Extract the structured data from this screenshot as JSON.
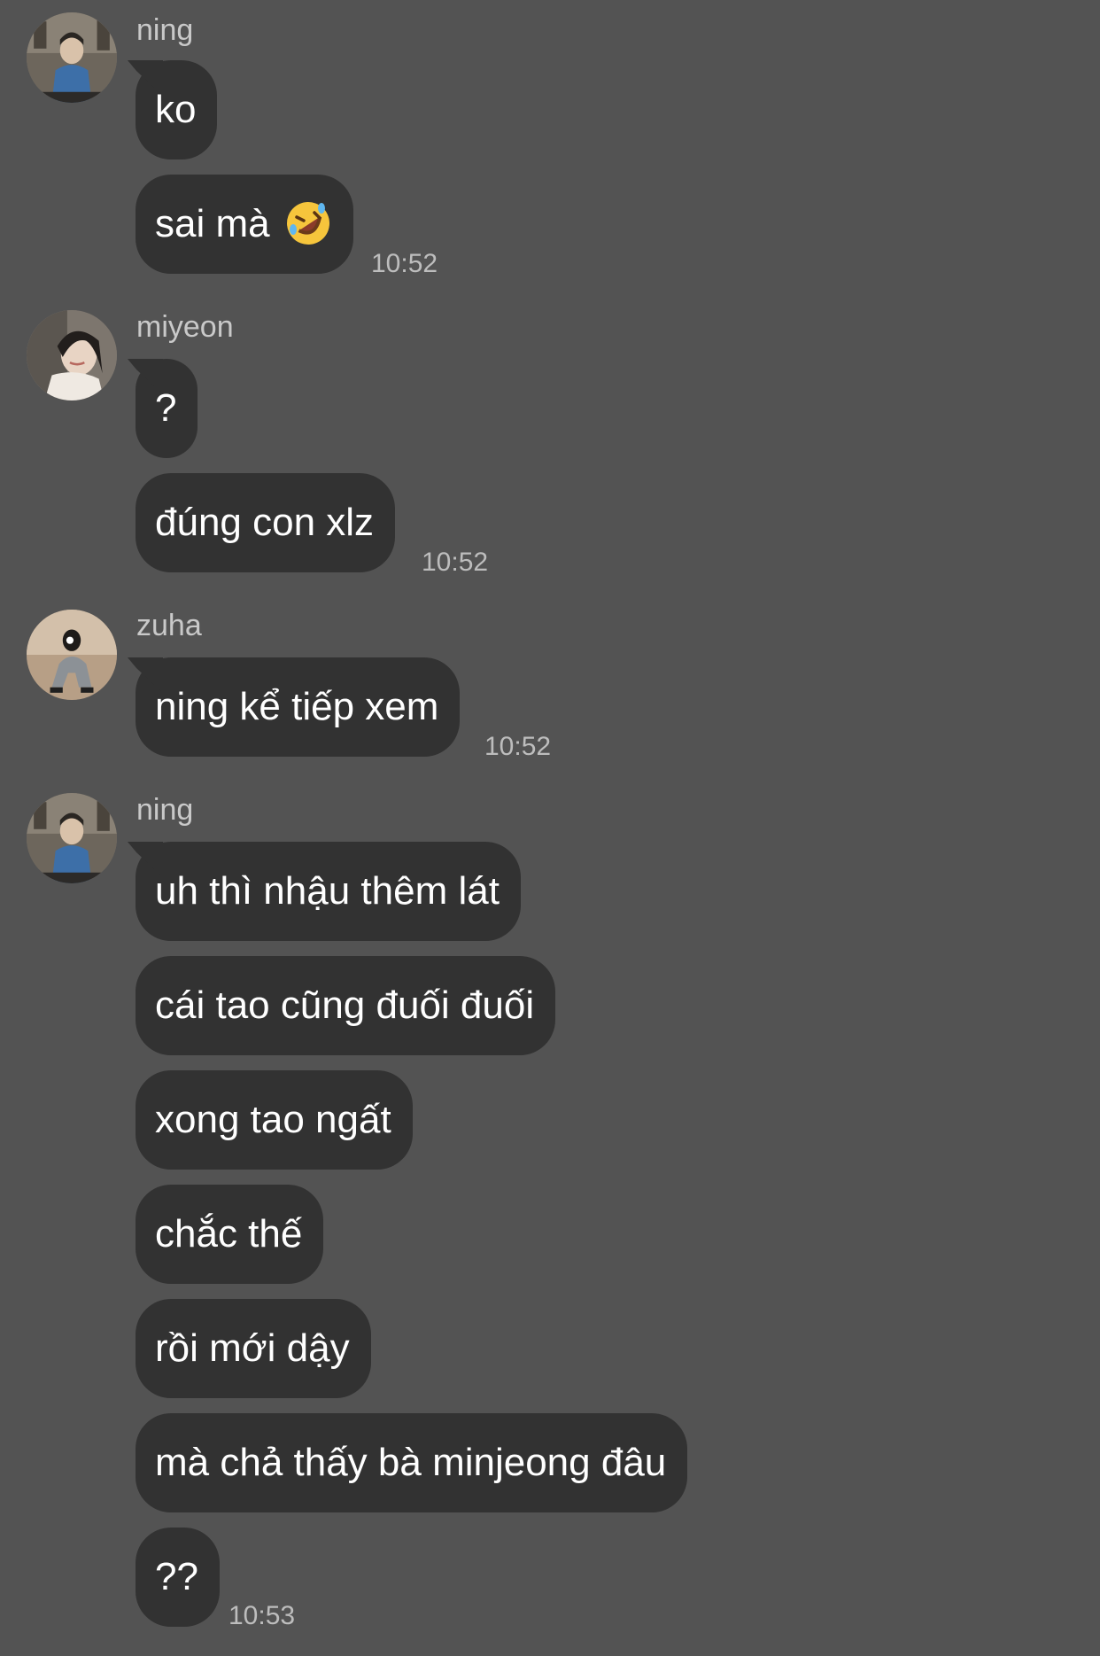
{
  "groups": [
    {
      "sender": "ning",
      "avatar": "ning-avatar",
      "messages": [
        "ko",
        "sai mà"
      ],
      "emoji": "rolling-on-floor-laughing-emoji",
      "time": "10:52"
    },
    {
      "sender": "miyeon",
      "avatar": "miyeon-avatar",
      "messages": [
        "?",
        "đúng con xlz"
      ],
      "time": "10:52"
    },
    {
      "sender": "zuha",
      "avatar": "zuha-avatar",
      "messages": [
        "ning kể tiếp xem"
      ],
      "time": "10:52"
    },
    {
      "sender": "ning",
      "avatar": "ning-avatar",
      "messages": [
        "uh thì nhậu thêm lát",
        "cái tao cũng đuối đuối",
        "xong tao ngất",
        "chắc thế",
        "rồi mới dậy",
        "mà chả thấy bà minjeong đâu",
        "??"
      ],
      "time": "10:53"
    }
  ],
  "colors": {
    "background": "#535353",
    "bubble": "#323232",
    "text": "#ffffff",
    "sender_name": "#c9c9c9",
    "timestamp": "#bdbdbd"
  }
}
